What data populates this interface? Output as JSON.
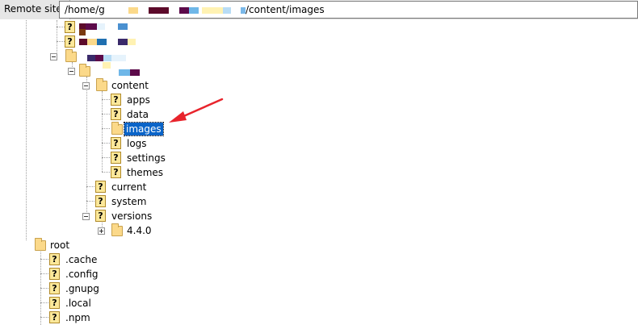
{
  "path_bar": {
    "label": "Remote site:",
    "path_prefix": "/home/g",
    "path_suffix": "/content/images"
  },
  "tree": {
    "content": "content",
    "apps": "apps",
    "data": "data",
    "images": "images",
    "logs": "logs",
    "settings": "settings",
    "themes": "themes",
    "current": "current",
    "system": "system",
    "versions": "versions",
    "v440": "4.4.0",
    "root": "root",
    "cache": ".cache",
    "config": ".config",
    "gnupg": ".gnupg",
    "local": ".local",
    "npm": ".npm"
  },
  "icons": {
    "unknown": "?",
    "folder": "folder-icon"
  },
  "colors": {
    "selection": "#0a64c8",
    "annotation_arrow": "#e8242c",
    "folder": "#fbd98a"
  }
}
